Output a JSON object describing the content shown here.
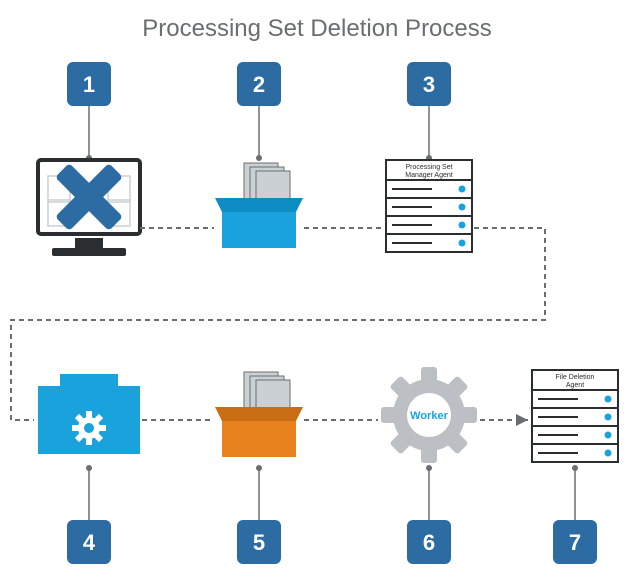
{
  "title": "Processing Set Deletion Process",
  "steps": {
    "s1": "1",
    "s2": "2",
    "s3": "3",
    "s4": "4",
    "s5": "5",
    "s6": "6",
    "s7": "7"
  },
  "labels": {
    "processing_set_manager_agent_l1": "Processing Set",
    "processing_set_manager_agent_l2": "Manager Agent",
    "file_deletion_agent_l1": "File Deletion",
    "file_deletion_agent_l2": "Agent",
    "worker": "Worker"
  },
  "colors": {
    "title": "#6a6e71",
    "badge_bg": "#2d6ca2",
    "badge_text": "#ffffff",
    "box_cyan": "#1aa2dc",
    "box_orange": "#e8821e",
    "gear_gray": "#bcc0c4",
    "worker_text": "#1aa2dc",
    "server_outline": "#2b2e31",
    "server_led": "#1aa2dc",
    "text_dark": "#2b2e31",
    "dash": "#6a6e71",
    "monitor_outline": "#2b2e31",
    "monitor_screen": "#ffffff",
    "monitor_x": "#2d6ca2",
    "doc_fill": "#cbd0d4",
    "doc_outline": "#6a6e71"
  }
}
